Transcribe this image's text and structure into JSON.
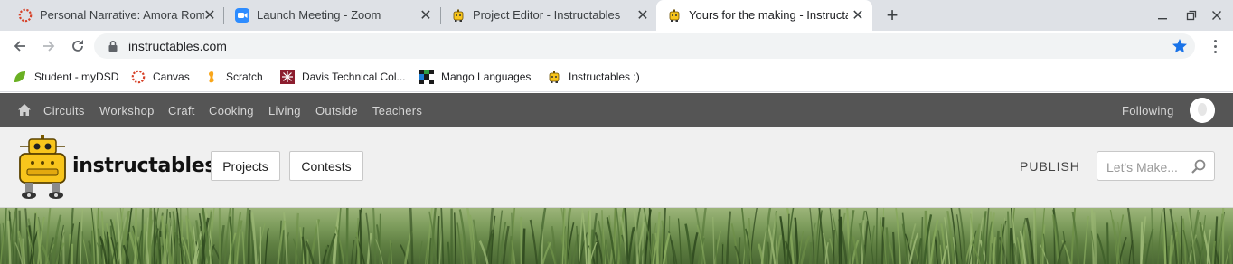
{
  "browser": {
    "tabs": [
      {
        "title": "Personal Narrative: Amora Rome",
        "icon": "canvas-icon",
        "active": false
      },
      {
        "title": "Launch Meeting - Zoom",
        "icon": "zoom-icon",
        "active": false
      },
      {
        "title": "Project Editor - Instructables",
        "icon": "instructables-robot-icon",
        "active": false
      },
      {
        "title": "Yours for the making - Instructab",
        "icon": "instructables-robot-icon",
        "active": true
      }
    ],
    "close_glyph": "✕",
    "new_tab_glyph": "+",
    "url": "instructables.com",
    "accent_color": "#1a73e8",
    "bookmarks": [
      {
        "label": "Student - myDSD",
        "icon": "leaf-icon"
      },
      {
        "label": "Canvas",
        "icon": "canvas-icon"
      },
      {
        "label": "Scratch",
        "icon": "scratch-icon"
      },
      {
        "label": "Davis Technical Col...",
        "icon": "davis-tech-icon"
      },
      {
        "label": "Mango Languages",
        "icon": "mango-icon"
      },
      {
        "label": "Instructables :)",
        "icon": "instructables-robot-icon"
      }
    ]
  },
  "site": {
    "nav": {
      "categories": [
        "Circuits",
        "Workshop",
        "Craft",
        "Cooking",
        "Living",
        "Outside",
        "Teachers"
      ],
      "following": "Following",
      "bg_color": "#555555"
    },
    "header": {
      "logo_text": "instructables",
      "projects_button": "Projects",
      "contests_button": "Contests",
      "publish": "PUBLISH",
      "search_placeholder": "Let's Make..."
    },
    "brand_color": "#f8c51c"
  }
}
